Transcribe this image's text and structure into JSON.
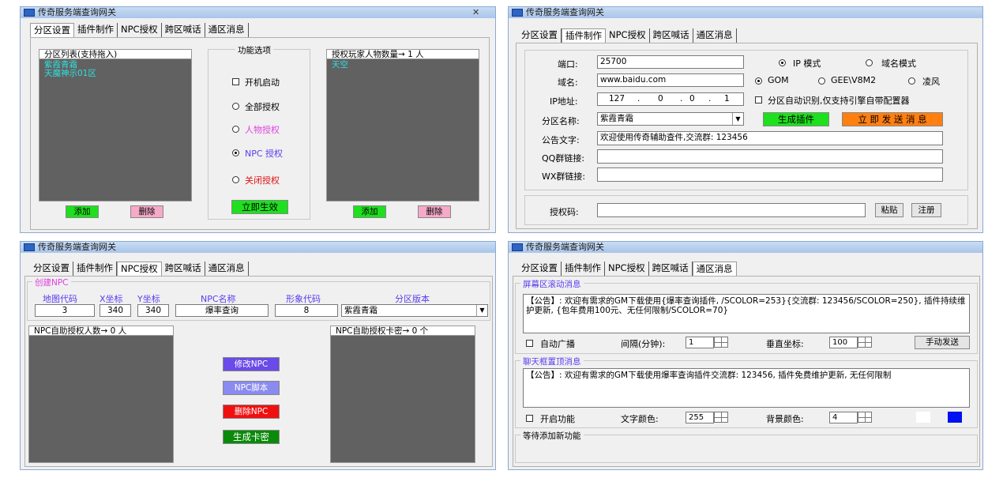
{
  "window_title": "传奇服务端查询网关",
  "tabs": [
    "分区设置",
    "插件制作",
    "NPC授权",
    "跨区喊话",
    "通区消息"
  ],
  "panel1": {
    "list_header": "分区列表(支持拖入)",
    "list_items": [
      "紫霞青霜",
      "天魔神示01区"
    ],
    "add": "添加",
    "delete": "删除",
    "func_title": "功能选项",
    "startup": "开机启动",
    "all_auth": "全部授权",
    "char_auth": "人物授权",
    "npc_auth": "NPC 授权",
    "close_auth": "关闭授权",
    "apply": "立即生效",
    "auth_header": "授权玩家人物数量→ 1 人",
    "auth_items": [
      "天空"
    ],
    "add2": "添加",
    "delete2": "删除",
    "colors": {
      "char": "#e040e0",
      "npc": "#5a3df0",
      "close": "#e01010"
    }
  },
  "panel2": {
    "port_label": "端口:",
    "port": "25700",
    "ip_mode": "IP 模式",
    "domain_mode": "域名模式",
    "domain_label": "域名:",
    "domain": "www.baidu.com",
    "gom": "GOM",
    "gee": "GEE\\V8M2",
    "lingfeng": "凌风",
    "ip_label": "IP地址:",
    "ip": [
      "127",
      "0",
      "0",
      "1"
    ],
    "auto_detect": "分区自动识别,仅支持引擎自带配置器",
    "zone_label": "分区名称:",
    "zone": "紫霞青霜",
    "gen_plugin": "生成插件",
    "send_now": "立 即 发 送 消 息",
    "notice_label": "公告文字:",
    "notice": "欢迎使用传奇辅助查件,交流群: 123456",
    "qq_label": "QQ群链接:",
    "wx_label": "WX群链接:",
    "code_label": "授权码:",
    "paste": "粘贴",
    "register": "注册"
  },
  "panel3": {
    "group_title": "创建NPC",
    "col_map": "地图代码",
    "col_x": "X坐标",
    "col_y": "Y坐标",
    "col_name": "NPC名称",
    "col_look": "形象代码",
    "col_ver": "分区版本",
    "map": "3",
    "x": "340",
    "y": "340",
    "name": "爆率查询",
    "look": "8",
    "ver": "紫霞青霜",
    "left_header": "NPC自助授权人数→ 0 人",
    "right_header": "NPC自助授权卡密→ 0 个",
    "modify": "修改NPC",
    "script": "NPC脚本",
    "delete": "删除NPC",
    "gen_card": "生成卡密"
  },
  "panel4": {
    "scroll_title": "屏幕区滚动消息",
    "scroll_text": "【公告】: 欢迎有需求的GM下载使用{爆率查询插件, /SCOLOR=253}{交流群: 123456/SCOLOR=250}, 插件持续维护更新, {包年费用100元、无任何限制/SCOLOR=70}",
    "auto_broadcast": "自动广播",
    "interval_label": "间隔(分钟):",
    "interval": "1",
    "vertical_label": "垂直坐标:",
    "vertical": "100",
    "manual_send": "手动发送",
    "chat_title": "聊天框置顶消息",
    "chat_text": "【公告】: 欢迎有需求的GM下载使用爆率查询插件交流群: 123456, 插件免费维护更新, 无任何限制",
    "enable": "开启功能",
    "text_color_label": "文字颜色:",
    "text_color": "255",
    "bg_color_label": "背景颜色:",
    "bg_color": "4",
    "pending": "等待添加新功能",
    "swatch_blue": "#0010f0"
  }
}
